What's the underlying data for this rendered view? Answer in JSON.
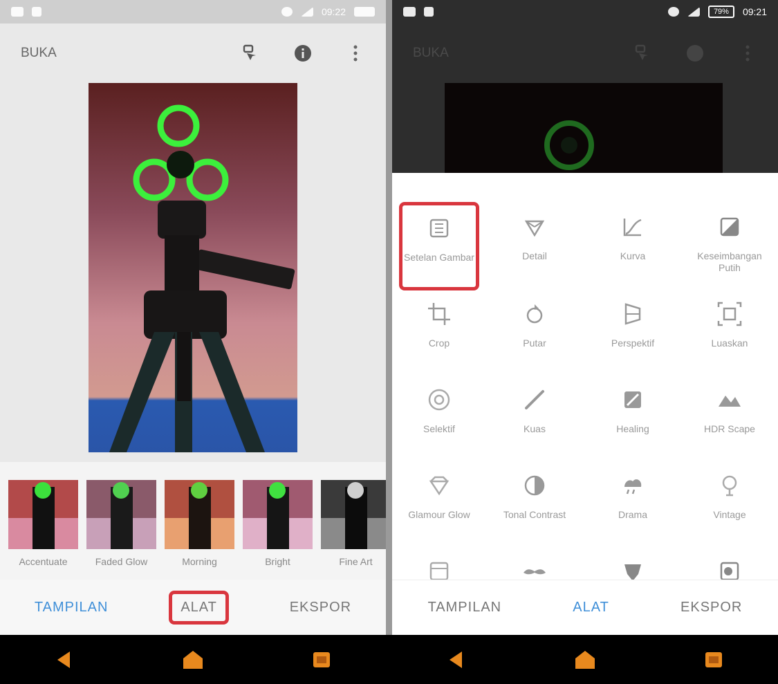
{
  "left": {
    "status": {
      "time": "09:22"
    },
    "app_title": "BUKA",
    "filters": [
      {
        "label": "Accentuate"
      },
      {
        "label": "Faded Glow"
      },
      {
        "label": "Morning"
      },
      {
        "label": "Bright"
      },
      {
        "label": "Fine Art"
      }
    ],
    "tabs": {
      "looks": "TAMPILAN",
      "tools": "ALAT",
      "export": "EKSPOR"
    }
  },
  "right": {
    "status": {
      "time": "09:21",
      "battery": "79%"
    },
    "app_title": "BUKA",
    "tools": [
      {
        "label": "Setelan Gambar",
        "icon": "tune-icon"
      },
      {
        "label": "Detail",
        "icon": "detail-triangle-icon"
      },
      {
        "label": "Kurva",
        "icon": "curves-icon"
      },
      {
        "label": "Keseimbangan Putih",
        "icon": "white-balance-icon"
      },
      {
        "label": "Crop",
        "icon": "crop-icon"
      },
      {
        "label": "Putar",
        "icon": "rotate-icon"
      },
      {
        "label": "Perspektif",
        "icon": "perspective-icon"
      },
      {
        "label": "Luaskan",
        "icon": "expand-icon"
      },
      {
        "label": "Selektif",
        "icon": "selective-icon"
      },
      {
        "label": "Kuas",
        "icon": "brush-icon"
      },
      {
        "label": "Healing",
        "icon": "healing-icon"
      },
      {
        "label": "HDR Scape",
        "icon": "hdr-icon"
      },
      {
        "label": "Glamour Glow",
        "icon": "glamour-icon"
      },
      {
        "label": "Tonal Contrast",
        "icon": "tonal-icon"
      },
      {
        "label": "Drama",
        "icon": "drama-icon"
      },
      {
        "label": "Vintage",
        "icon": "vintage-icon"
      },
      {
        "label": "",
        "icon": "grainy-film-icon"
      },
      {
        "label": "",
        "icon": "mustache-icon"
      },
      {
        "label": "",
        "icon": "grunge-icon"
      },
      {
        "label": "",
        "icon": "noir-icon"
      }
    ],
    "tabs": {
      "looks": "TAMPILAN",
      "tools": "ALAT",
      "export": "EKSPOR"
    }
  },
  "colors": {
    "accent": "#3f8fd8",
    "highlight": "#d9363e",
    "nav_orange": "#e8891e"
  }
}
